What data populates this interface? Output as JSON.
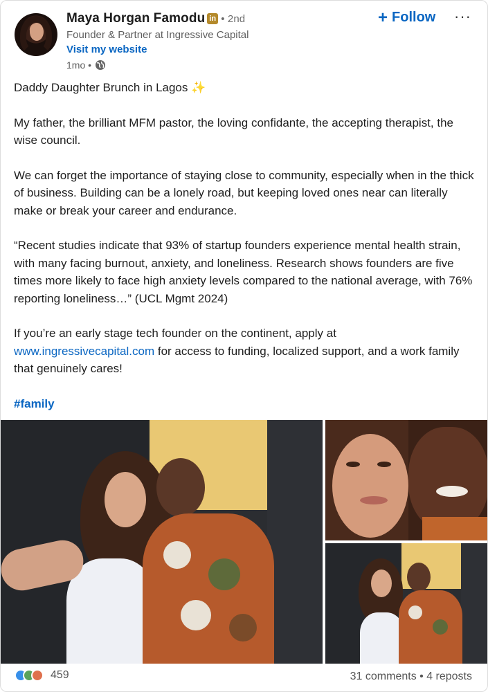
{
  "author": {
    "name": "Maya Horgan Famodu",
    "badge": "in",
    "degree": "• 2nd",
    "headline": "Founder & Partner at Ingressive Capital",
    "website_label": "Visit my website",
    "time": "1mo •"
  },
  "actions": {
    "follow_label": "Follow",
    "more_label": "···"
  },
  "post": {
    "p1": "Daddy Daughter Brunch in Lagos",
    "p1_emoji": "✨",
    "p2": "My father, the brilliant MFM pastor, the loving confidante, the accepting therapist, the wise council.",
    "p3": "We can forget the importance of staying close to community, especially when in the thick of business. Building can be a lonely road, but keeping loved ones near can literally make or break your career and endurance.",
    "p4": "“Recent studies indicate that 93% of startup founders experience mental health strain, with many facing burnout, anxiety, and loneliness. Research shows founders are five times more likely to face high anxiety levels compared to the national average, with 76% reporting loneliness…” (UCL Mgmt 2024)",
    "p5_before": "If you’re an early stage tech founder on the continent, apply at",
    "p5_link": "www.ingressivecapital.com",
    "p5_after": "for access to funding, localized support, and a work family that genuinely cares!",
    "hashtag": "#family"
  },
  "footer": {
    "reaction_count": "459",
    "stats": "31 comments • 4 reposts"
  },
  "colors": {
    "link": "#0a66c2",
    "follow": "#0a66c2"
  },
  "icons": [
    "globe-icon",
    "plus-icon",
    "more-icon",
    "like-reaction-icon",
    "celebrate-reaction-icon",
    "love-reaction-icon"
  ]
}
